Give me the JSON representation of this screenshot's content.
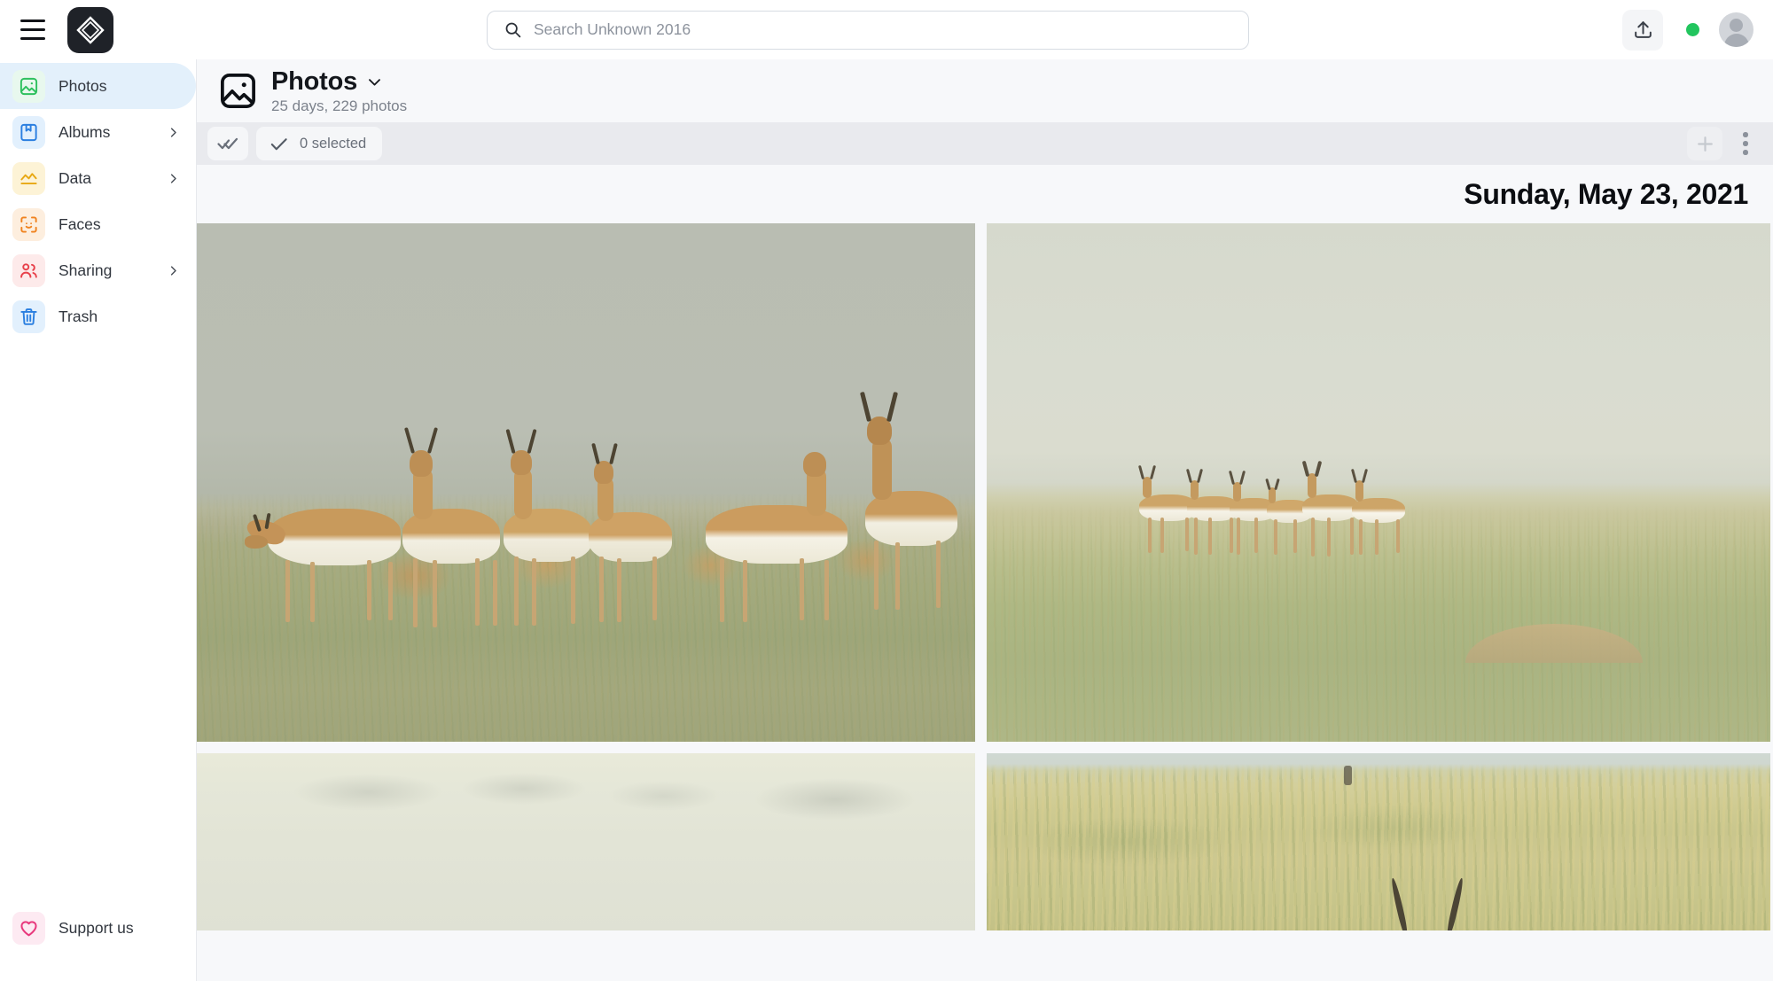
{
  "app": {
    "logo_icon": "diamond-logo-icon",
    "menu_icon": "hamburger-menu-icon"
  },
  "search": {
    "placeholder": "Search Unknown 2016",
    "value": "",
    "icon": "search-icon"
  },
  "topbar": {
    "upload_icon": "upload-icon",
    "status_dot_color": "#22c55e",
    "avatar_icon": "user-avatar-icon"
  },
  "sidebar": {
    "items": [
      {
        "label": "Photos",
        "icon": "photos-icon",
        "active": true,
        "has_chevron": false,
        "icon_bg": "#e8f8ee",
        "icon_color": "#2ec05e"
      },
      {
        "label": "Albums",
        "icon": "albums-icon",
        "active": false,
        "has_chevron": true,
        "icon_bg": "#e2f0fd",
        "icon_color": "#2b7fe0"
      },
      {
        "label": "Data",
        "icon": "data-chart-icon",
        "active": false,
        "has_chevron": true,
        "icon_bg": "#fdf3d6",
        "icon_color": "#e8a813"
      },
      {
        "label": "Faces",
        "icon": "faces-icon",
        "active": false,
        "has_chevron": false,
        "icon_bg": "#fdeede",
        "icon_color": "#f0821e"
      },
      {
        "label": "Sharing",
        "icon": "sharing-icon",
        "active": false,
        "has_chevron": true,
        "icon_bg": "#fdeaea",
        "icon_color": "#e8404a"
      },
      {
        "label": "Trash",
        "icon": "trash-icon",
        "active": false,
        "has_chevron": false,
        "icon_bg": "#e2f0fd",
        "icon_color": "#2b7fe0"
      }
    ],
    "support": {
      "label": "Support us",
      "icon": "heart-icon",
      "icon_bg": "#fdeaf2",
      "icon_color": "#e8397d"
    }
  },
  "main_header": {
    "icon": "photo-frame-icon",
    "title": "Photos",
    "chevron_icon": "chevron-down-icon",
    "subtitle": "25 days, 229 photos"
  },
  "toolbar": {
    "select_all_icon": "double-check-icon",
    "selected_check_icon": "check-icon",
    "selected_label": "0 selected",
    "add_icon": "plus-icon",
    "more_icon": "more-vertical-icon"
  },
  "gallery": {
    "date_heading": "Sunday, May 23, 2021",
    "rows": [
      {
        "tiles": [
          {
            "name": "pronghorn-herd-closeup",
            "alt": "Group of pronghorn antelope standing in prairie grass under overcast sky"
          },
          {
            "name": "pronghorn-herd-distant",
            "alt": "Distant herd of pronghorn antelope on a green grassland ridge"
          }
        ]
      },
      {
        "tiles": [
          {
            "name": "hazy-sky-landscape",
            "alt": "Pale hazy sky over faint horizon"
          },
          {
            "name": "grassland-with-horns",
            "alt": "Tall prairie grass with pronghorn horns emerging at bottom"
          }
        ]
      }
    ]
  },
  "colors": {
    "accent_blue": "#2b7fe0",
    "active_nav_bg": "#e3f0fb",
    "toolbar_bg": "#e9eaee",
    "content_bg": "#f7f8fa",
    "status_green": "#22c55e"
  }
}
